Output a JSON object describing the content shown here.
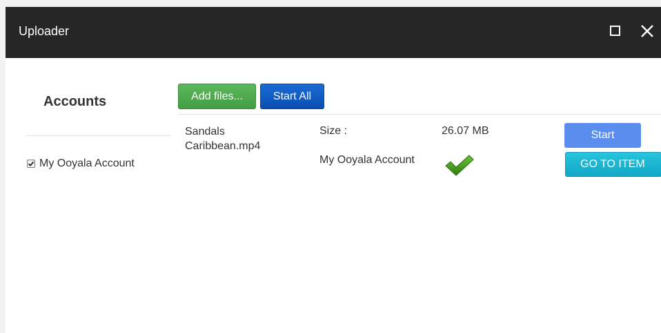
{
  "window": {
    "title": "Uploader"
  },
  "sidebar": {
    "heading": "Accounts",
    "accounts": [
      {
        "label": "My Ooyala Account",
        "checked": true
      }
    ]
  },
  "toolbar": {
    "add_files_label": "Add files...",
    "start_all_label": "Start All"
  },
  "files": [
    {
      "name": "Sandals Caribbean.mp4",
      "size_label": "Size :",
      "size_value": "26.07 MB",
      "account": "My Ooyala Account",
      "status": "complete",
      "start_label": "Start",
      "goto_label": "GO TO ITEM"
    }
  ],
  "icons": {
    "maximize": "maximize-icon",
    "close": "close-icon",
    "status_check": "checkmark-icon"
  },
  "colors": {
    "titlebar": "#262626",
    "add_files": "#4cae4c",
    "start_all": "#0d5ac1",
    "start": "#5b8def",
    "goto_item": "#1bb5d1",
    "check": "#3a8a1c"
  }
}
